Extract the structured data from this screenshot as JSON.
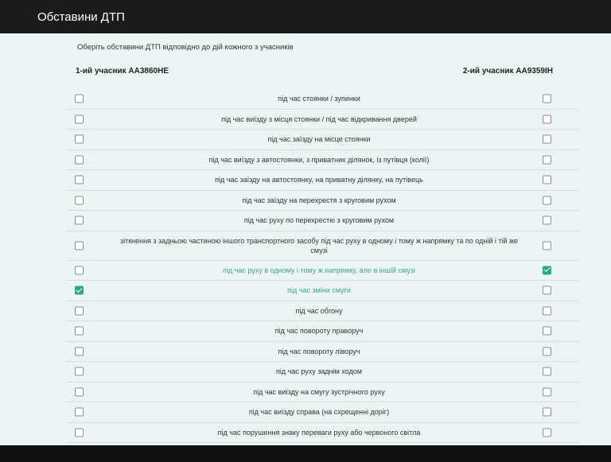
{
  "window": {
    "title": "Обставини ДТП"
  },
  "instruction": "Оберіть обставини ДТП відповідно до дій кожного з учасників",
  "participants": {
    "first": "1-ий учасник АА3860НЕ",
    "second": "2-ий учасник АА9359ІН"
  },
  "colors": {
    "accent": "#2eaa83",
    "header": "#1b1b1b",
    "panel": "#ecf4f4"
  },
  "circumstances": [
    {
      "label": "під час стоянки / зупинки",
      "p1": false,
      "p2": false
    },
    {
      "label": "під час виїзду з місця стоянки / під час відкривання дверей",
      "p1": false,
      "p2": false
    },
    {
      "label": "під час заїзду на місце стоянки",
      "p1": false,
      "p2": false
    },
    {
      "label": "під час виїзду з автостоянки, з приватних ділянок, із путівця (колії)",
      "p1": false,
      "p2": false
    },
    {
      "label": "під час заїзду на автостоянку, на приватну ділянку, на путівець",
      "p1": false,
      "p2": false
    },
    {
      "label": "під час заїзду на перехрестя з круговим рухом",
      "p1": false,
      "p2": false
    },
    {
      "label": "під час руху по перехрестю з круговим рухом",
      "p1": false,
      "p2": false
    },
    {
      "label": "зіткнення з задньою частиною іншого транспортного засобу під час руху в одному і тому ж напрямку та по одній і тій же смузі",
      "p1": false,
      "p2": false
    },
    {
      "label": "під час руху в одному і тому ж напрямку, але в іншій смузі",
      "p1": false,
      "p2": true
    },
    {
      "label": "під час зміни смуги",
      "p1": true,
      "p2": false
    },
    {
      "label": "під час обгону",
      "p1": false,
      "p2": false
    },
    {
      "label": "під час повороту праворуч",
      "p1": false,
      "p2": false
    },
    {
      "label": "під час повороту ліворуч",
      "p1": false,
      "p2": false
    },
    {
      "label": "під час руху заднім ходом",
      "p1": false,
      "p2": false
    },
    {
      "label": "під час виїзду на смугу зустрічного руху",
      "p1": false,
      "p2": false
    },
    {
      "label": "під час виїзду справа (на схрещенні доріг)",
      "p1": false,
      "p2": false
    },
    {
      "label": "під час порушення знаку переваги руху або червоного світла",
      "p1": false,
      "p2": false
    }
  ]
}
